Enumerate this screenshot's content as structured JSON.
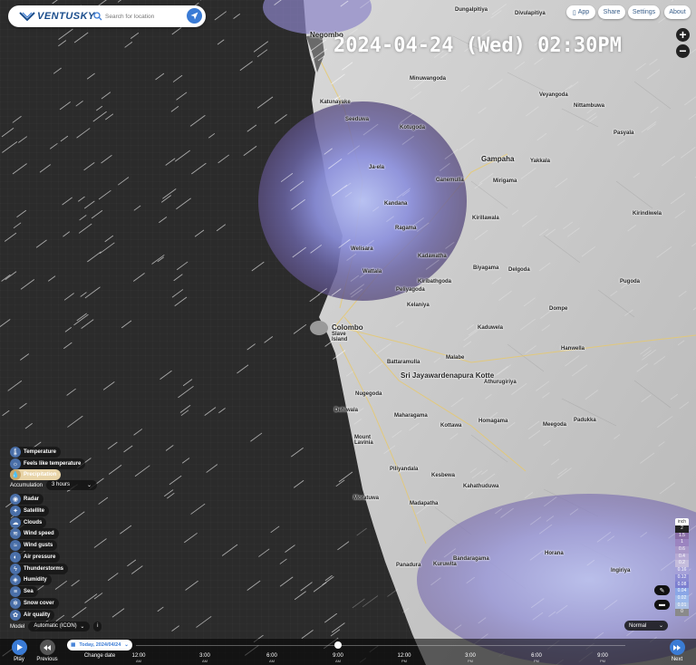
{
  "header": {
    "logo_text": "VENTUSKY",
    "search_placeholder": "Search for location"
  },
  "top_menu": {
    "app": "App",
    "share": "Share",
    "settings": "Settings",
    "about": "About"
  },
  "datetime": "2024-04-24 (Wed) 02:30PM",
  "zoom": {
    "in": "+",
    "out": "−"
  },
  "layers": [
    {
      "label": "Temperature",
      "icon": "thermometer-icon",
      "glyph": "🌡"
    },
    {
      "label": "Feels like temperature",
      "icon": "feels-like-icon",
      "glyph": "☼"
    },
    {
      "label": "Precipitation",
      "icon": "raindrop-icon",
      "glyph": "💧"
    },
    {
      "label": "Radar",
      "icon": "radar-icon",
      "glyph": "◉"
    },
    {
      "label": "Satellite",
      "icon": "satellite-icon",
      "glyph": "✦"
    },
    {
      "label": "Clouds",
      "icon": "cloud-icon",
      "glyph": "☁"
    },
    {
      "label": "Wind speed",
      "icon": "wind-icon",
      "glyph": "≋"
    },
    {
      "label": "Wind gusts",
      "icon": "gust-icon",
      "glyph": "≈"
    },
    {
      "label": "Air pressure",
      "icon": "pressure-icon",
      "glyph": "◐"
    },
    {
      "label": "Thunderstorms",
      "icon": "lightning-icon",
      "glyph": "ϟ"
    },
    {
      "label": "Humidity",
      "icon": "humidity-icon",
      "glyph": "◈"
    },
    {
      "label": "Sea",
      "icon": "waves-icon",
      "glyph": "≡"
    },
    {
      "label": "Snow cover",
      "icon": "snowflake-icon",
      "glyph": "❄"
    },
    {
      "label": "Air quality",
      "icon": "air-quality-icon",
      "glyph": "✿"
    }
  ],
  "accumulation": {
    "label": "Accumulation",
    "value": "3 hours"
  },
  "model": {
    "label": "Model",
    "value": "Automatic (ICON)",
    "info": "i"
  },
  "legend": {
    "unit": "inch",
    "values": [
      "2",
      "1.5",
      "1",
      "0.6",
      "0.4",
      "0.2",
      "0.16",
      "0.12",
      "0.08",
      "0.04",
      "0.02",
      "0.01",
      "0"
    ],
    "colors": [
      "#222",
      "#8a6fa8",
      "#9b84c0",
      "#a998c8",
      "#b7aad4",
      "#c4bcdc",
      "#a5a1d8",
      "#8a8ad2",
      "#7c7fd0",
      "#8aa6e6",
      "#9bb8ea",
      "#aac0e4",
      "#8a8a8a"
    ]
  },
  "view": {
    "value": "Normal"
  },
  "timeline": {
    "play": "Play",
    "previous": "Previous",
    "date_pill": "Today, 2024/04/24",
    "change_date": "Change date",
    "next": "Next",
    "ticks": [
      {
        "time": "12:00",
        "ap": "AM"
      },
      {
        "time": "3:00",
        "ap": "AM"
      },
      {
        "time": "6:00",
        "ap": "AM"
      },
      {
        "time": "9:00",
        "ap": "AM"
      },
      {
        "time": "12:00",
        "ap": "PM"
      },
      {
        "time": "3:00",
        "ap": "PM"
      },
      {
        "time": "6:00",
        "ap": "PM"
      },
      {
        "time": "9:00",
        "ap": "PM"
      }
    ]
  },
  "map_labels": {
    "negombo": "Negombo",
    "colombo": "Colombo",
    "slave_island": "Slave Island",
    "gampaha": "Gampaha",
    "sjkotte": "Sri Jayawardenapura Kotte",
    "mount_lavinia": "Mount Lavinia",
    "dungalpitiya": "Dungalpitiya",
    "divulapitiya": "Divulapitiya",
    "peliyagoda": "Peliyagoda",
    "kelaniya": "Kelaniya",
    "kadawatha": "Kadawatha",
    "kiribathgoda": "Kiribathgoda",
    "ja_ela": "Ja-ela",
    "kandana": "Kandana",
    "ragama": "Ragama",
    "wattala": "Wattala",
    "minuwangoda": "Minuwangoda",
    "veyangoda": "Veyangoda",
    "yakkala": "Yakkala",
    "kirindiwela": "Kirindiwela",
    "malabe": "Malabe",
    "maharagama": "Maharagama",
    "homagama": "Homagama",
    "kottawa": "Kottawa",
    "piliyandala": "Piliyandala",
    "kesbewa": "Kesbewa",
    "moratuwa": "Moratuwa",
    "panadura": "Panadura",
    "horana": "Horana",
    "padukka": "Padukka",
    "hanwella": "Hanwella",
    "kaduwela": "Kaduwela",
    "athurugiriya": "Athurugiriya",
    "dehiwala": "Dehiwala",
    "nugegoda": "Nugegoda",
    "battaramulla": "Battaramulla",
    "seeduwa": "Seeduwa",
    "katunayake": "Katunayake",
    "kotugoda": "Kotugoda",
    "ganemulla": "Ganemulla",
    "pugoda": "Pugoda",
    "dompe": "Dompe",
    "delgoda": "Delgoda",
    "biyagama": "Biyagama",
    "mirigama": "Mirigama",
    "nittambuwa": "Nittambuwa",
    "pasyala": "Pasyala",
    "bandaragama": "Bandaragama",
    "kuruwita": "Kuruwita",
    "meegoda": "Meegoda",
    "ingiriya": "Ingiriya",
    "kahathuduwa": "Kahathuduwa",
    "madapatha": "Madapatha",
    "kirillawala": "Kirillawala",
    "welisara": "Welisara"
  }
}
